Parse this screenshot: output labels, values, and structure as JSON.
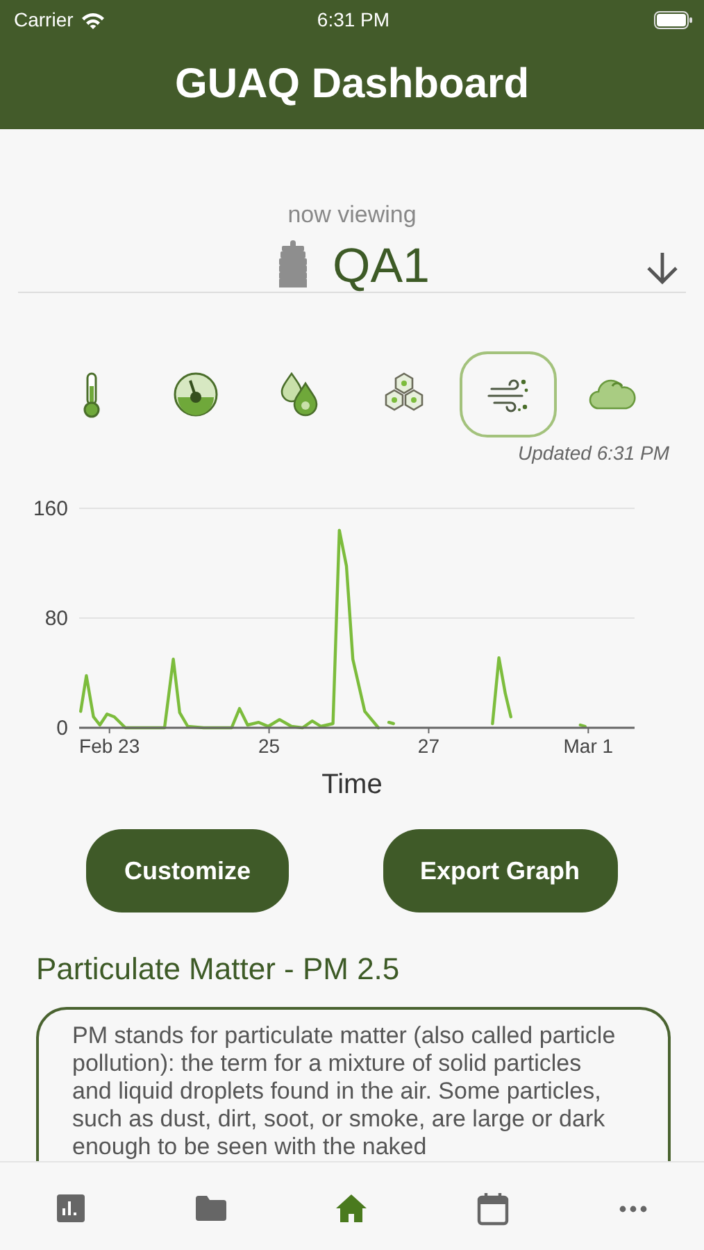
{
  "status_bar": {
    "carrier": "Carrier",
    "time": "6:31 PM"
  },
  "header": {
    "title": "GUAQ Dashboard"
  },
  "viewing": {
    "label": "now viewing",
    "sensor": "QA1"
  },
  "metrics": [
    {
      "kind": "temperature",
      "selected": false
    },
    {
      "kind": "pressure",
      "selected": false
    },
    {
      "kind": "humidity",
      "selected": false
    },
    {
      "kind": "voc",
      "selected": false
    },
    {
      "kind": "particulate",
      "selected": true
    },
    {
      "kind": "cloud",
      "selected": false
    }
  ],
  "updated": "Updated 6:31 PM",
  "chart": {
    "chart_data": {
      "type": "line",
      "xlabel": "Time",
      "xlim": [
        22.62,
        29.58
      ],
      "ylim": [
        0,
        160
      ],
      "xticks": [
        {
          "value": 23,
          "label": "Feb 23"
        },
        {
          "value": 25,
          "label": "25"
        },
        {
          "value": 27,
          "label": "27"
        },
        {
          "value": 29,
          "label": "Mar 1"
        }
      ],
      "yticks": [
        0,
        80,
        160
      ],
      "x": [
        22.64,
        22.71,
        22.8,
        22.88,
        22.97,
        23.06,
        23.2,
        23.69,
        23.8,
        23.88,
        23.98,
        24.18,
        24.53,
        24.63,
        24.73,
        24.87,
        24.99,
        25.13,
        25.28,
        25.42,
        25.54,
        25.65,
        25.8,
        25.88,
        25.97,
        26.05,
        26.2,
        26.37,
        26.5,
        26.56,
        27.8,
        27.88,
        27.96,
        28.03,
        28.9,
        28.96
      ],
      "series": [
        {
          "color": "#7cbc3c",
          "values": [
            12,
            38,
            8,
            2,
            10,
            8,
            0,
            0,
            50,
            11,
            1,
            0,
            0,
            14,
            2,
            4,
            1,
            6,
            1,
            0,
            5,
            1,
            3,
            144,
            118,
            50,
            12,
            0,
            null,
            null,
            null,
            null,
            null,
            null,
            null,
            null
          ]
        },
        {
          "color": "#7bbb3b",
          "values": [
            null,
            null,
            null,
            null,
            null,
            null,
            null,
            null,
            null,
            null,
            null,
            null,
            null,
            null,
            null,
            null,
            null,
            null,
            null,
            null,
            null,
            null,
            null,
            null,
            null,
            null,
            null,
            null,
            4,
            3,
            null,
            null,
            null,
            null,
            null,
            null
          ]
        },
        {
          "color": "#7dbd3d",
          "values": [
            null,
            null,
            null,
            null,
            null,
            null,
            null,
            null,
            null,
            null,
            null,
            null,
            null,
            null,
            null,
            null,
            null,
            null,
            null,
            null,
            null,
            null,
            null,
            null,
            null,
            null,
            null,
            null,
            null,
            null,
            3,
            51,
            25,
            8,
            null,
            null
          ]
        },
        {
          "color": "#7aba3a",
          "values": [
            null,
            null,
            null,
            null,
            null,
            null,
            null,
            null,
            null,
            null,
            null,
            null,
            null,
            null,
            null,
            null,
            null,
            null,
            null,
            null,
            null,
            null,
            null,
            null,
            null,
            null,
            null,
            null,
            null,
            null,
            null,
            null,
            null,
            null,
            2,
            1
          ]
        }
      ]
    }
  },
  "buttons": [
    {
      "label": "Customize"
    },
    {
      "label": "Export Graph"
    }
  ],
  "info": {
    "title": "Particulate Matter - PM 2.5",
    "text": "PM stands for particulate matter (also called particle pollution): the term for a mixture of solid particles and liquid droplets found in the air. Some particles, such as dust, dirt, soot, or smoke, are large or dark enough to be seen with the naked"
  },
  "tab_bar": [
    {
      "kind": "chart",
      "selected": false
    },
    {
      "kind": "folder",
      "selected": false
    },
    {
      "kind": "home",
      "selected": true
    },
    {
      "kind": "calendar",
      "selected": false
    },
    {
      "kind": "more",
      "selected": false
    }
  ]
}
